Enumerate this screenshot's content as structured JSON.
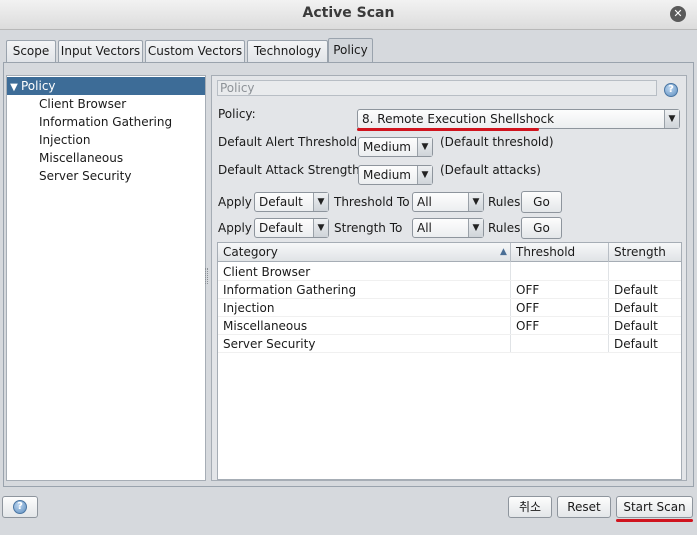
{
  "window": {
    "title": "Active Scan"
  },
  "tabs": [
    "Scope",
    "Input Vectors",
    "Custom Vectors",
    "Technology",
    "Policy"
  ],
  "active_tab": "Policy",
  "tree": {
    "root": "Policy",
    "children": [
      "Client Browser",
      "Information Gathering",
      "Injection",
      "Miscellaneous",
      "Server Security"
    ]
  },
  "panel": {
    "header": "Policy",
    "policy_label": "Policy:",
    "policy_value": "8. Remote Execution Shellshock",
    "alert_label": "Default Alert Threshold:",
    "alert_value": "Medium",
    "alert_note": "(Default threshold)",
    "strength_label": "Default Attack Strength:",
    "strength_value": "Medium",
    "strength_note": "(Default attacks)",
    "apply1": {
      "apply": "Apply",
      "value": "Default",
      "to": "Threshold To",
      "target": "All",
      "rules": "Rules",
      "go": "Go"
    },
    "apply2": {
      "apply": "Apply",
      "value": "Default",
      "to": "Strength To",
      "target": "All",
      "rules": "Rules",
      "go": "Go"
    }
  },
  "table": {
    "headers": [
      "Category",
      "Threshold",
      "Strength"
    ],
    "rows": [
      [
        "Client Browser",
        "",
        ""
      ],
      [
        "Information Gathering",
        "OFF",
        "Default"
      ],
      [
        "Injection",
        "OFF",
        "Default"
      ],
      [
        "Miscellaneous",
        "OFF",
        "Default"
      ],
      [
        "Server Security",
        "",
        "Default"
      ]
    ]
  },
  "footer": {
    "cancel": "취소",
    "reset": "Reset",
    "start": "Start Scan"
  },
  "colors": {
    "selection": "#3d6c97",
    "highlight_underline": "#d0141e"
  }
}
